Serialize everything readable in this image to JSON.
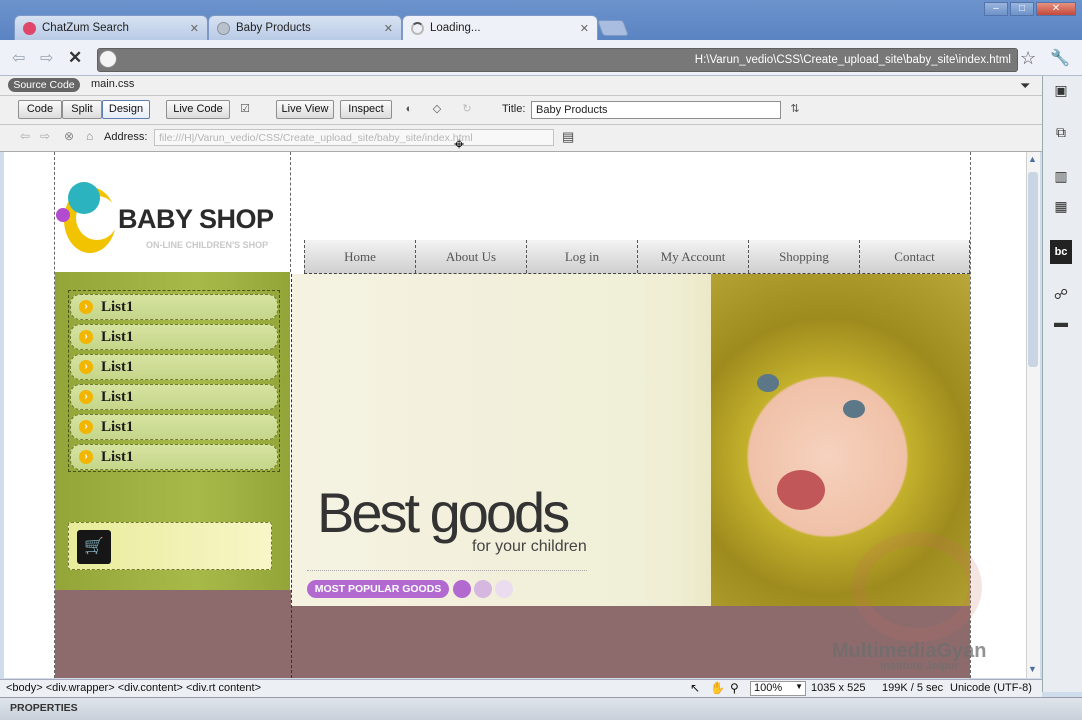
{
  "browser": {
    "tabs": [
      {
        "label": "ChatZum Search",
        "favicon_color": "#e0466a"
      },
      {
        "label": "Baby Products",
        "favicon_color": "#9aa3ae"
      },
      {
        "label": "Loading...",
        "favicon_color": "#bbbbbb"
      }
    ],
    "window_buttons": [
      "‒",
      "□",
      "✕"
    ],
    "address": "H:\\Varun_vedio\\CSS\\Create_upload_site\\baby_site\\index.html"
  },
  "dw": {
    "source_code": "Source Code",
    "css_file": "main.css",
    "view_buttons": [
      "Code",
      "Split",
      "Design"
    ],
    "live_code": "Live Code",
    "live_view": "Live View",
    "inspect": "Inspect",
    "title_label": "Title:",
    "title_value": "Baby Products",
    "address_label": "Address:",
    "address_value": "file:///H|/Varun_vedio/CSS/Create_upload_site/baby_site/index.html"
  },
  "site": {
    "logo_main": "BABY SHOP",
    "logo_sub": "ON-LINE CHILDREN'S SHOP",
    "menu": [
      "Home",
      "About Us",
      "Log in",
      "My Account",
      "Shopping",
      "Contact"
    ],
    "list_items": [
      "List1",
      "List1",
      "List1",
      "List1",
      "List1",
      "List1"
    ],
    "banner_title": "Best goods",
    "banner_sub": "for your children",
    "banner_button": "MOST POPULAR GOODS",
    "colors": {
      "sidebar_green": "#96a83a",
      "bottom_mauve": "#8d6b6d",
      "purple": "#b36ad0"
    }
  },
  "watermark": {
    "line1": "MultimediaGyan",
    "line2": "Institute Jaipur"
  },
  "status": {
    "tag_path": "<body> <div.wrapper> <div.content> <div.rt  content>",
    "zoom": "100%",
    "dimensions": "1035 x 525",
    "size_time": "199K / 5 sec",
    "encoding": "Unicode (UTF-8)"
  },
  "properties_label": "PROPERTIES"
}
